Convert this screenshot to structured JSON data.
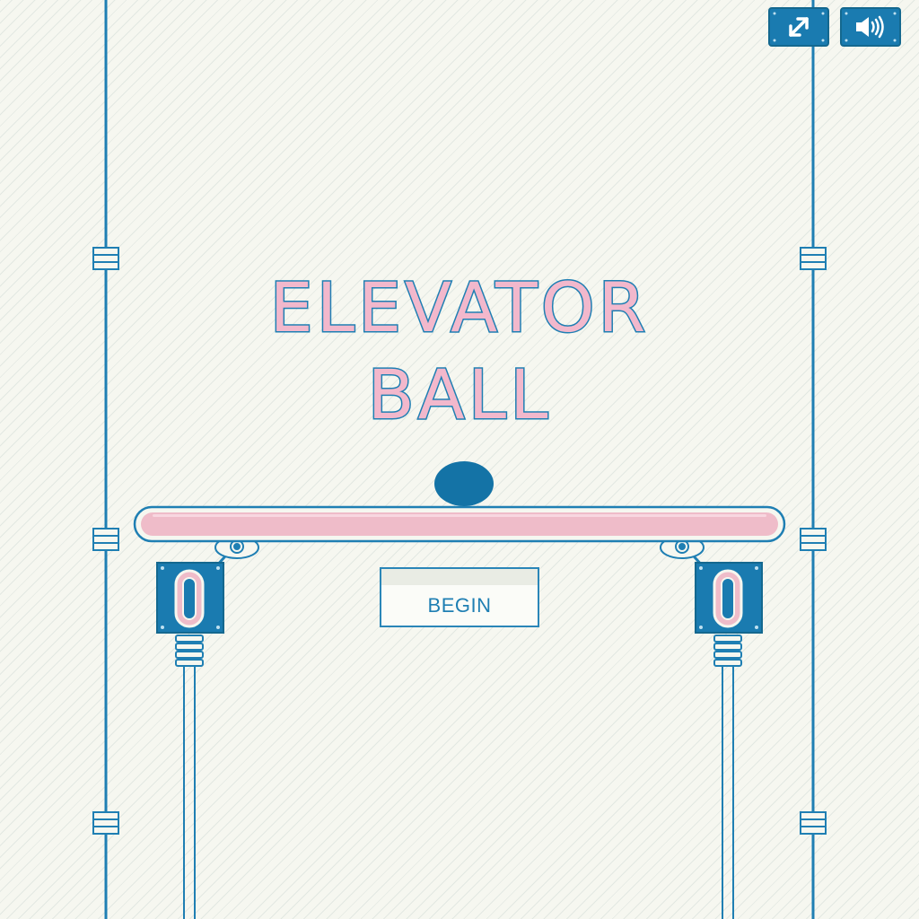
{
  "game": {
    "title_line_1": "ELEVATOR",
    "title_line_2": "BALL"
  },
  "buttons": {
    "begin_label": "BEGIN",
    "fullscreen_icon": "fullscreen-arrows-icon",
    "sound_icon": "speaker-on-icon"
  },
  "colors": {
    "background": "#f6f7f0",
    "line_blue": "#1f7fb3",
    "ball_blue": "#1473a6",
    "platform_pink": "#efbcc9",
    "title_fill": "#f2b8cc"
  }
}
